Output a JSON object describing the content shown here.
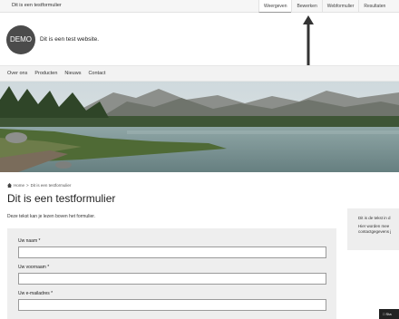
{
  "admin_bar": {
    "title": "Dit is een testformulier",
    "tabs": [
      {
        "label": "Weergeven",
        "active": true
      },
      {
        "label": "Bewerken",
        "active": false
      },
      {
        "label": "Webformulier",
        "active": false
      },
      {
        "label": "Resultaten",
        "active": false
      }
    ]
  },
  "site": {
    "logo_text": "DEMO",
    "name": "Dit is een test website."
  },
  "nav": {
    "items": [
      "Over ons",
      "Producten",
      "Nieuws",
      "Contact"
    ]
  },
  "breadcrumb": {
    "home": "Home",
    "separator": ">",
    "current": "Dit is een testformulier"
  },
  "content": {
    "title": "Dit is een testformulier",
    "intro": "Deze tekst kan je lezen boven het formulier."
  },
  "form": {
    "fields": [
      {
        "label": "Uw naam *",
        "value": ""
      },
      {
        "label": "Uw voornaam *",
        "value": ""
      },
      {
        "label": "Uw e-mailadres *",
        "value": ""
      }
    ]
  },
  "sidebar": {
    "line1": "Dit is de tekst in d",
    "line2": "Hier worden mee",
    "line3": "contactgegevens j"
  },
  "chat": {
    "label": "Sta"
  },
  "colors": {
    "admin_bar_bg": "#f6f6f6",
    "logo_bg": "#4b4b4b",
    "form_bg": "#eeeeee",
    "chat_bg": "#222222"
  }
}
